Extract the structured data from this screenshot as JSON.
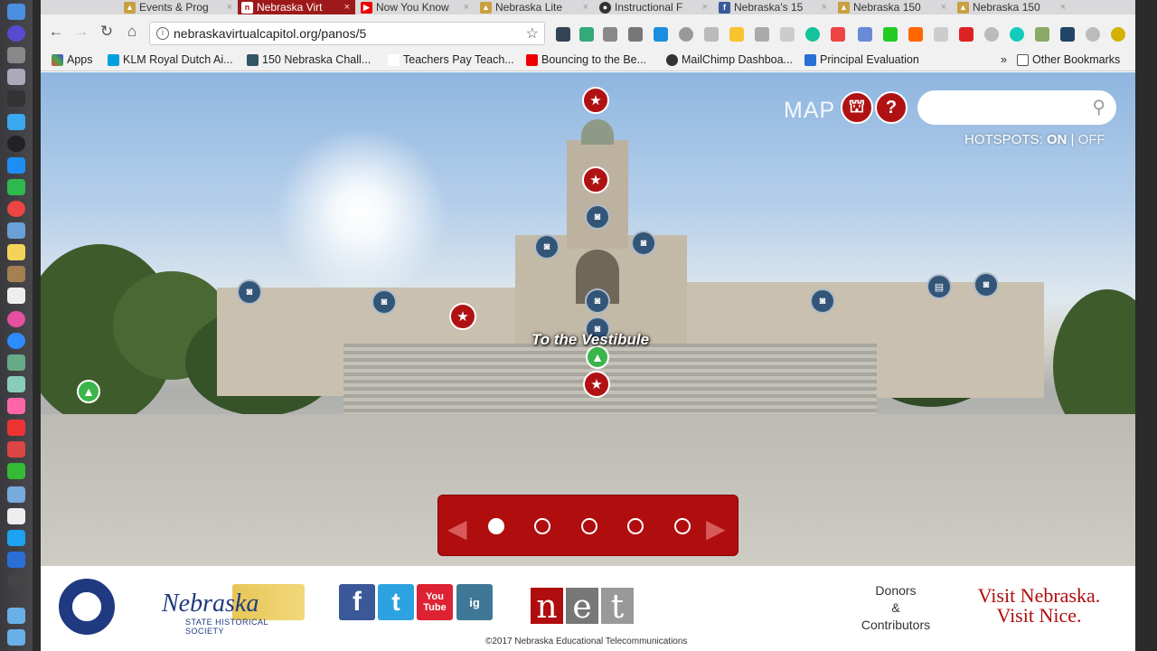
{
  "tabs": [
    {
      "label": "Events & Prog",
      "icon": "capitol-icon"
    },
    {
      "label": "Nebraska Virt",
      "icon": "nebraska-n-icon"
    },
    {
      "label": "Now You Know",
      "icon": "youtube-icon"
    },
    {
      "label": "Nebraska Lite",
      "icon": "capitol-icon"
    },
    {
      "label": "Instructional F",
      "icon": "github-icon"
    },
    {
      "label": "Nebraska's 15",
      "icon": "facebook-icon"
    },
    {
      "label": "Nebraska 150",
      "icon": "capitol-icon"
    },
    {
      "label": "Nebraska 150",
      "icon": "capitol-icon"
    }
  ],
  "address": {
    "url": "nebraskavirtualcapitol.org/panos/5"
  },
  "bookmarks": [
    {
      "label": "Apps"
    },
    {
      "label": "KLM Royal Dutch Ai..."
    },
    {
      "label": "150 Nebraska Chall..."
    },
    {
      "label": "Teachers Pay Teach..."
    },
    {
      "label": "Bouncing to the Be..."
    },
    {
      "label": "MailChimp Dashboa..."
    },
    {
      "label": "Principal Evaluation"
    },
    {
      "label": "Other Bookmarks"
    }
  ],
  "pano": {
    "map_label": "MAP",
    "help_glyph": "?",
    "hotspots_prefix": "HOTSPOTS:",
    "hotspots_on": "ON",
    "hotspots_sep": "|",
    "hotspots_off": "OFF",
    "vestibule_label": "To the Vestibule",
    "pager_active_index": 1,
    "pager_count": 5
  },
  "footer": {
    "social": [
      "f",
      "t",
      "You Tube",
      "ig"
    ],
    "net_letters": [
      "n",
      "e",
      "t"
    ],
    "donors_line1": "Donors",
    "donors_line2": "&",
    "donors_line3": "Contributors",
    "visit_line1": "Visit Nebraska.",
    "visit_line2": "Visit Nice.",
    "nehs_script": "Nebraska",
    "nehs_sub": "STATE HISTORICAL SOCIETY",
    "copyright": "©2017 Nebraska Educational Telecommunications"
  },
  "colors": {
    "accent": "#b00d0f",
    "hotspot_green": "#3ab54a",
    "camera": "#335577"
  }
}
